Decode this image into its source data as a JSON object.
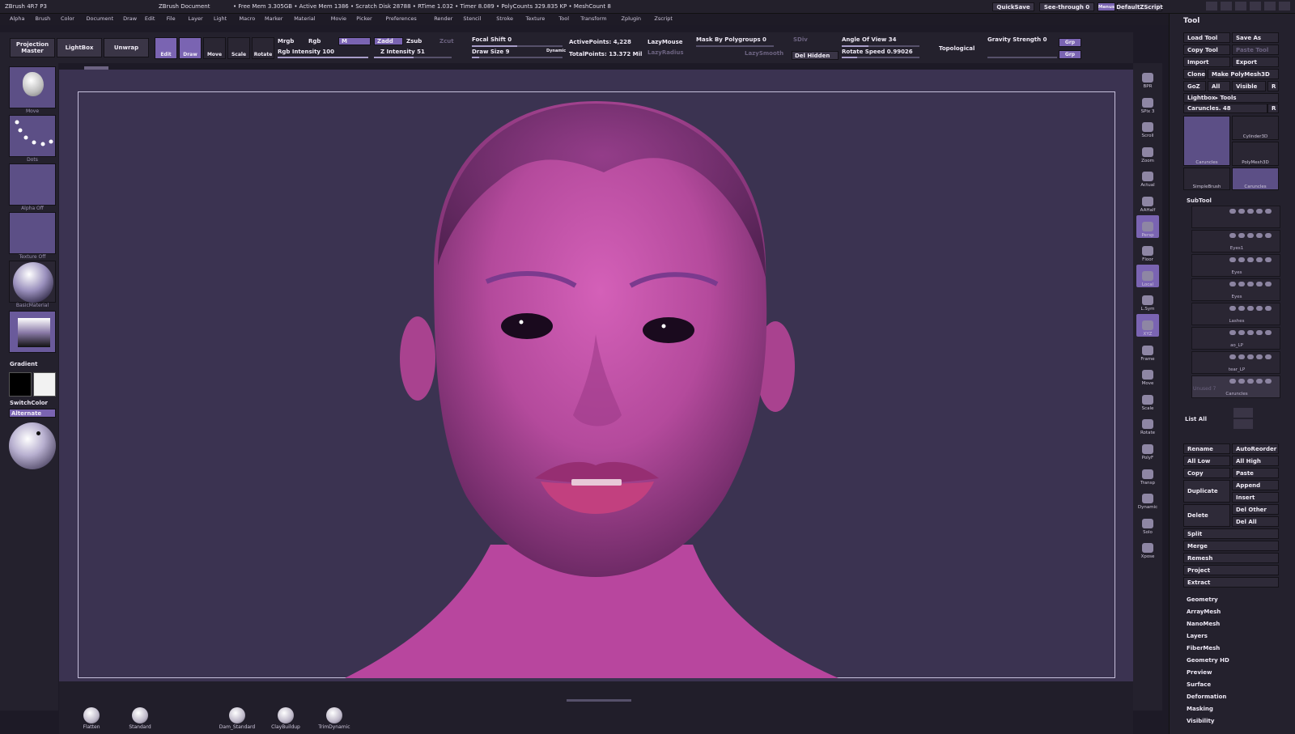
{
  "titlebar": {
    "app": "ZBrush 4R7 P3",
    "document": "ZBrush Document",
    "stats": "• Free Mem 3.305GB • Active Mem 1386 • Scratch Disk 28788 • RTime 1.032 • Timer 8.089 • PolyCounts 329.835 KP • MeshCount 8",
    "quicksave": "QuickSave",
    "see_through": "See-through  0",
    "menus": "Menus",
    "script": "DefaultZScript"
  },
  "menu": [
    "Alpha",
    "Brush",
    "Color",
    "Document",
    "Draw",
    "Edit",
    "File",
    "Layer",
    "Light",
    "Macro",
    "Marker",
    "Material",
    "Movie",
    "Picker",
    "Preferences",
    "Render",
    "Stencil",
    "Stroke",
    "Texture",
    "Tool",
    "Transform",
    "Zplugin",
    "Zscript"
  ],
  "shelf": {
    "projection_master": "Projection Master",
    "lightbox": "LightBox",
    "unwrap": "Unwrap",
    "edit": "Edit",
    "draw": "Draw",
    "move": "Move",
    "scale": "Scale",
    "rotate": "Rotate",
    "mrgb": "Mrgb",
    "rgb": "Rgb",
    "m": "M",
    "rgb_intensity": "Rgb Intensity 100",
    "zadd": "Zadd",
    "zsub": "Zsub",
    "zcut": "Zcut",
    "z_intensity": "Z Intensity 51",
    "focal_shift": "Focal Shift 0",
    "draw_size": "Draw Size 9",
    "dynamic": "Dynamic",
    "active_points": "ActivePoints: 4,228",
    "total_points": "TotalPoints: 13.372 Mil",
    "lazymouse": "LazyMouse",
    "lazyradius": "LazyRadius",
    "mask_polygroups": "Mask By Polygroups 0",
    "lazysmooth": "LazySmooth",
    "sdiv": "SDiv",
    "del_hidden": "Del Hidden",
    "angle_of_view": "Angle Of View 34",
    "rotate_speed": "Rotate Speed 0.99026",
    "topological": "Topological",
    "gravity": "Gravity Strength 0",
    "grp1": "Grp",
    "grp2": "Grp"
  },
  "left": {
    "move": "Move",
    "dots": "Dots",
    "alpha_off": "Alpha Off",
    "texture_off": "Texture Off",
    "basic_material": "BasicMaterial",
    "gradient": "Gradient",
    "switch_color": "SwitchColor",
    "alternate": "Alternate"
  },
  "right_shelf": [
    {
      "label": "BPR",
      "on": false
    },
    {
      "label": "SPix 3",
      "on": false
    },
    {
      "label": "Scroll",
      "on": false
    },
    {
      "label": "Zoom",
      "on": false
    },
    {
      "label": "Actual",
      "on": false
    },
    {
      "label": "AAHalf",
      "on": false
    },
    {
      "label": "Persp",
      "on": true
    },
    {
      "label": "Floor",
      "on": false
    },
    {
      "label": "Local",
      "on": true
    },
    {
      "label": "L.Sym",
      "on": false
    },
    {
      "label": "XYZ",
      "on": true
    },
    {
      "label": "Frame",
      "on": false
    },
    {
      "label": "Move",
      "on": false
    },
    {
      "label": "Scale",
      "on": false
    },
    {
      "label": "Rotate",
      "on": false
    },
    {
      "label": "PolyF",
      "on": false
    },
    {
      "label": "Transp",
      "on": false
    },
    {
      "label": "Dynamic",
      "on": false
    },
    {
      "label": "Solo",
      "on": false
    },
    {
      "label": "Xpose",
      "on": false
    }
  ],
  "tool": {
    "title": "Tool",
    "load_tool": "Load Tool",
    "save_as": "Save As",
    "copy_tool": "Copy Tool",
    "paste_tool": "Paste Tool",
    "import": "Import",
    "export": "Export",
    "clone": "Clone",
    "make_polymesh": "Make PolyMesh3D",
    "goz": "GoZ",
    "all": "All",
    "visible": "Visible",
    "r": "R",
    "lightbox_tools": "Lightbox▸ Tools",
    "caruncles_slider": "Caruncles. 48",
    "thumbs": [
      "Caruncles",
      "Cylinder3D",
      "PolyMesh3D",
      "SimpleBrush",
      "Caruncles"
    ],
    "subtool_title": "SubTool",
    "subtools": [
      "",
      "Eyes1",
      "Eyes",
      "Eyes",
      "Lashes",
      "ao_LP",
      "tear_LP",
      "Caruncles"
    ],
    "unused": "Unused 7",
    "list_all": "List All",
    "rename": "Rename",
    "auto_reorder": "AutoReorder",
    "all_low": "All Low",
    "all_high": "All High",
    "copy": "Copy",
    "paste": "Paste",
    "duplicate": "Duplicate",
    "append": "Append",
    "insert": "Insert",
    "delete": "Delete",
    "del_other": "Del Other",
    "del_all": "Del All",
    "actions": [
      "Split",
      "Merge",
      "Remesh",
      "Project",
      "Extract"
    ],
    "sections": [
      "Geometry",
      "ArrayMesh",
      "NanoMesh",
      "Layers",
      "FiberMesh",
      "Geometry HD",
      "Preview",
      "Surface",
      "Deformation",
      "Masking",
      "Visibility"
    ]
  },
  "bottom": {
    "brushes": [
      "Flatten",
      "Standard",
      "Dam_Standard",
      "ClayBuildup",
      "TrimDynamic"
    ]
  }
}
